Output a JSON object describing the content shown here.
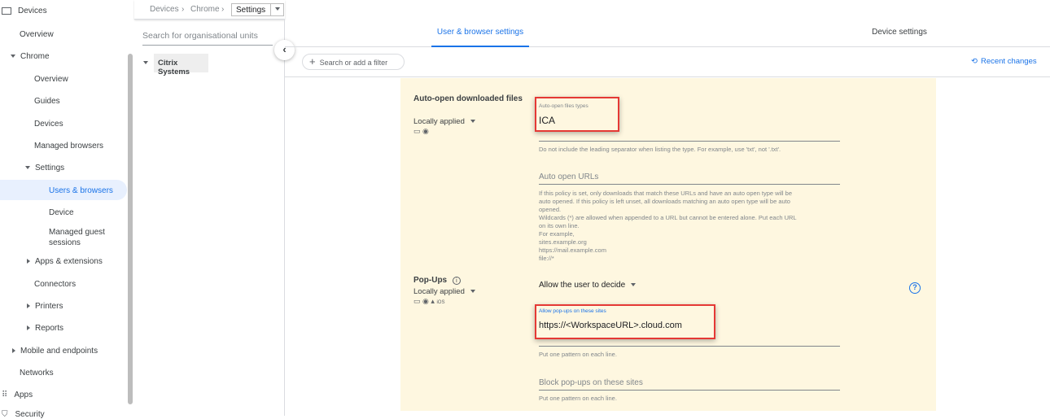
{
  "sidebar": {
    "items": [
      {
        "label": "Devices"
      },
      {
        "label": "Overview"
      },
      {
        "label": "Chrome"
      },
      {
        "label": "Overview"
      },
      {
        "label": "Guides"
      },
      {
        "label": "Devices"
      },
      {
        "label": "Managed browsers"
      },
      {
        "label": "Settings"
      },
      {
        "label": "Users & browsers"
      },
      {
        "label": "Device"
      },
      {
        "label": "Managed guest sessions"
      },
      {
        "label": "Apps & extensions"
      },
      {
        "label": "Connectors"
      },
      {
        "label": "Printers"
      },
      {
        "label": "Reports"
      },
      {
        "label": "Mobile and endpoints"
      },
      {
        "label": "Networks"
      },
      {
        "label": "Apps"
      },
      {
        "label": "Security"
      }
    ]
  },
  "breadcrumb": {
    "items": [
      "Devices",
      "Chrome"
    ],
    "current": "Settings"
  },
  "org": {
    "search_placeholder": "Search for organisational units",
    "unit": "Citrix Systems"
  },
  "tabs": [
    "User & browser settings",
    "Device settings"
  ],
  "filter": {
    "placeholder": "Search or add a filter"
  },
  "recent_changes": "Recent changes",
  "settings": {
    "autoopen": {
      "title": "Auto-open downloaded files",
      "applied": "Locally applied",
      "types_label": "Auto-open files types",
      "types_value": "ICA",
      "types_help": "Do not include the leading separator when listing the type. For example, use 'txt', not '.txt'.",
      "urls_label": "Auto open URLs",
      "urls_help": [
        "If this policy is set, only downloads that match these URLs and have an auto open type will be auto opened. If this policy is left unset, all downloads matching an auto open type will be auto opened.",
        "Wildcards (*) are allowed when appended to a URL but cannot be entered alone. Put each URL on its own line.",
        "For example,",
        "sites.example.org",
        "https://mail.example.com",
        "file://*"
      ]
    },
    "popups": {
      "title": "Pop-Ups",
      "applied": "Locally applied",
      "ios": "iOS",
      "mode": "Allow the user to decide",
      "allow_label": "Allow pop-ups on these sites",
      "allow_value": "https://<WorkspaceURL>.cloud.com",
      "allow_help": "Put one pattern on each line.",
      "block_label": "Block pop-ups on these sites",
      "block_help": "Put one pattern on each line."
    }
  },
  "colors": {
    "accent": "#1a73e8",
    "card": "#fef7e0",
    "highlight": "#e53935"
  }
}
